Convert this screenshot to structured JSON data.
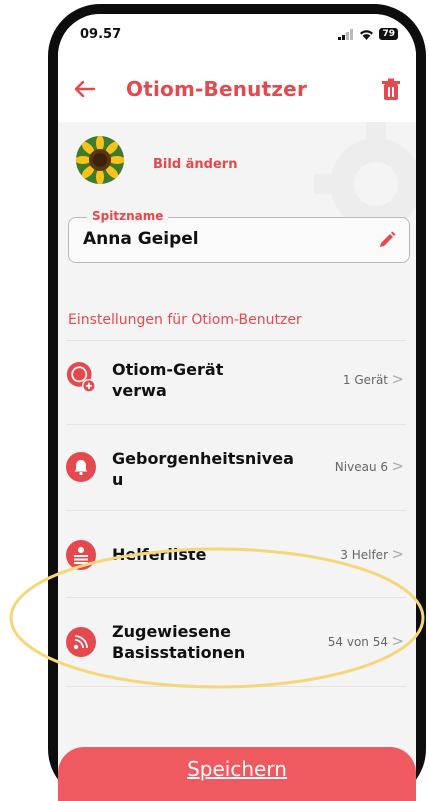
{
  "status_bar": {
    "time": "09.57",
    "battery": "79"
  },
  "header": {
    "title": "Otiom-Benutzer"
  },
  "profile": {
    "change_photo_label": "Bild ändern"
  },
  "nickname": {
    "label": "Spitzname",
    "value": "Anna Geipel"
  },
  "settings": {
    "section_title": "Einstellungen für Otiom-Benutzer",
    "items": [
      {
        "label_line1": "Otiom-Gerät",
        "label_line2": "verwa",
        "value": "1 Gerät",
        "icon": "device-add-icon"
      },
      {
        "label_line1": "Geborgenheitsnivea",
        "label_line2": "u",
        "value": "Niveau 6",
        "icon": "bell-icon"
      },
      {
        "label_line1": "Helferliste",
        "label_line2": "",
        "value": "3 Helfer",
        "icon": "helper-list-icon"
      },
      {
        "label_line1": "Zugewiesene",
        "label_line2": "Basisstationen",
        "value": "54 von 54",
        "icon": "base-station-icon"
      }
    ],
    "chevron": ">"
  },
  "save": {
    "label": "Speichern"
  },
  "colors": {
    "accent": "#e5484d",
    "highlight": "#f5d77a",
    "save_bg": "#ee5a5f"
  }
}
